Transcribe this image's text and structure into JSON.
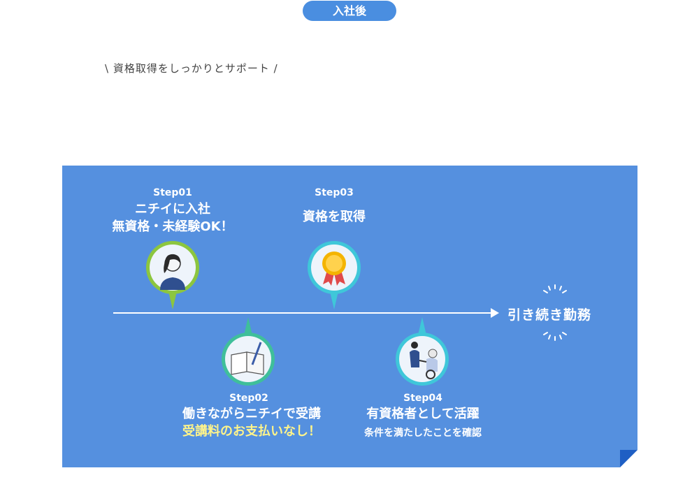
{
  "header": {
    "badge": "入社後",
    "tagline": "\\ 資格取得をしっかりとサポート /"
  },
  "timeline": {
    "end_label": "引き続き勤務",
    "steps": [
      {
        "step": "Step01",
        "line1": "ニチイに入社",
        "line2": "無資格・未経験OK！",
        "icon": "staff-person-icon"
      },
      {
        "step": "Step02",
        "line1": "働きながらニチイで受講",
        "line2": "受講料のお支払いなし！",
        "icon": "notebook-pen-icon"
      },
      {
        "step": "Step03",
        "line1": "資格を取得",
        "icon": "award-medal-icon"
      },
      {
        "step": "Step04",
        "line1": "有資格者として活躍",
        "note": "条件を満たしたことを確認",
        "icon": "caregiver-wheelchair-icon"
      }
    ]
  },
  "colors": {
    "panel": "#5590df",
    "accent": "#4a8ee0",
    "step01_ring": "#8cc63f",
    "step02_ring": "#3fbf9a",
    "step03_ring": "#3fc7d9",
    "step04_ring": "#3fc7d9",
    "highlight": "#fff48a"
  }
}
